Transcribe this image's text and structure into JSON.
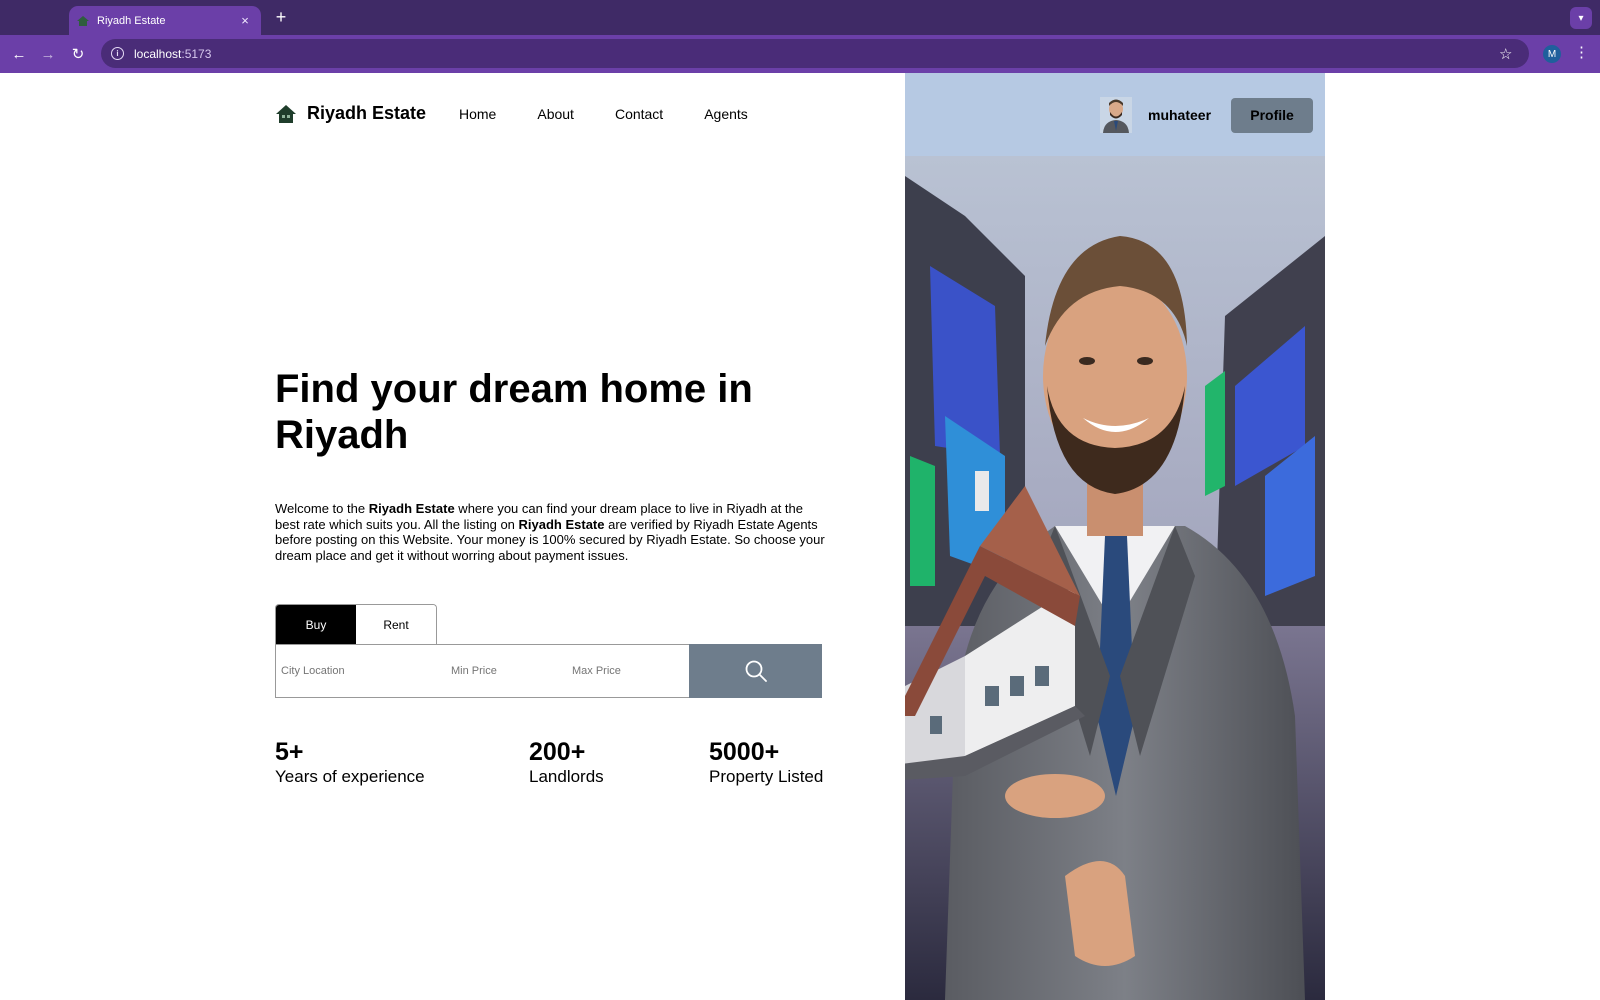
{
  "browser": {
    "tab_title": "Riyadh Estate",
    "tab_close": "×",
    "new_tab": "+",
    "url_host": "localhost",
    "url_port": ":5173",
    "profile_initial": "M"
  },
  "header": {
    "brand": "Riyadh Estate",
    "nav": [
      "Home",
      "About",
      "Contact",
      "Agents"
    ],
    "username": "muhateer",
    "profile_button": "Profile"
  },
  "hero": {
    "title": "Find your dream home in Riyadh",
    "desc_1": "Welcome to the ",
    "desc_brand_1": "Riyadh Estate",
    "desc_2": " where you can find your dream place to live in Riyadh at the best rate which suits you. All the listing on ",
    "desc_brand_2": "Riyadh Estate",
    "desc_3": " are verified by Riyadh Estate Agents before posting on this Website. Your money is 100% secured by Riyadh Estate. So choose your dream place and get it without worring about payment issues."
  },
  "search": {
    "tabs": [
      "Buy",
      "Rent"
    ],
    "active_tab": "Buy",
    "city_placeholder": "City Location",
    "min_placeholder": "Min Price",
    "max_placeholder": "Max Price"
  },
  "stats": [
    {
      "value": "5+",
      "label": "Years of experience"
    },
    {
      "value": "200+",
      "label": "Landlords"
    },
    {
      "value": "5000+",
      "label": "Property Listed"
    }
  ],
  "colors": {
    "tabbar": "#3f2a66",
    "toolbar": "#6b3fa8",
    "panel": "#b6c9e3",
    "accent_button": "#6e7d8c"
  }
}
